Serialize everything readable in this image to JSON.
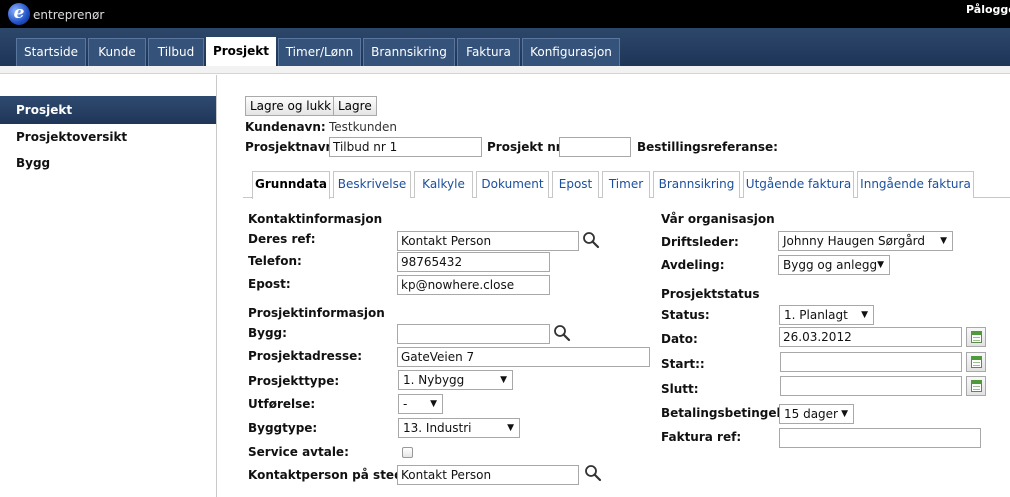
{
  "app": {
    "logo_letter": "e",
    "logo_text": "entreprenør",
    "login_label": "Pålogget"
  },
  "nav": {
    "tabs": [
      "Startside",
      "Kunde",
      "Tilbud",
      "Prosjekt",
      "Timer/Lønn",
      "Brannsikring",
      "Faktura",
      "Konfigurasjon"
    ],
    "active": "Prosjekt"
  },
  "sidebar": {
    "items": [
      "Prosjekt",
      "Prosjektoversikt",
      "Bygg"
    ],
    "active": "Prosjekt"
  },
  "toolbar": {
    "save_close_label": "Lagre og lukk",
    "save_label": "Lagre"
  },
  "header": {
    "customer_label": "Kundenavn:",
    "customer_value": "Testkunden",
    "project_name_label": "Prosjektnavn:",
    "project_name_value": "Tilbud nr 1",
    "project_nr_label": "Prosjekt nr:",
    "project_nr_value": "",
    "order_ref_label": "Bestillingsreferanse:"
  },
  "content_tabs": {
    "tabs": [
      "Grunndata",
      "Beskrivelse",
      "Kalkyle",
      "Dokument",
      "Epost",
      "Timer",
      "Brannsikring",
      "Utgående faktura",
      "Inngående faktura"
    ],
    "active": "Grunndata"
  },
  "contact": {
    "section_title": "Kontaktinformasjon",
    "ref_label": "Deres ref:",
    "ref_value": "Kontakt Person",
    "phone_label": "Telefon:",
    "phone_value": "98765432",
    "email_label": "Epost:",
    "email_value": "kp@nowhere.close"
  },
  "project_info": {
    "section_title": "Prosjektinformasjon",
    "building_label": "Bygg:",
    "building_value": "",
    "address_label": "Prosjektadresse:",
    "address_value": "GateVeien 7",
    "type_label": "Prosjekttype:",
    "type_value": "1. Nybygg",
    "execution_label": "Utførelse:",
    "execution_value": "-",
    "building_type_label": "Byggtype:",
    "building_type_value": "13. Industri",
    "service_label": "Service avtale:",
    "service_checked": false,
    "onsite_contact_label": "Kontaktperson på stedet:",
    "onsite_contact_value": "Kontakt Person"
  },
  "organisation": {
    "section_title": "Vår organisasjon",
    "manager_label": "Driftsleder:",
    "manager_value": "Johnny Haugen Sørgård",
    "department_label": "Avdeling:",
    "department_value": "Bygg og anlegg"
  },
  "status": {
    "section_title": "Prosjektstatus",
    "status_label": "Status:",
    "status_value": "1. Planlagt",
    "date_label": "Dato:",
    "date_value": "26.03.2012",
    "start_label": "Start::",
    "start_value": "",
    "end_label": "Slutt:",
    "end_value": "",
    "payment_label": "Betalingsbetingelse",
    "payment_value": "15 dager",
    "invoice_ref_label": "Faktura ref:",
    "invoice_ref_value": ""
  },
  "icons": {
    "search": "search-icon",
    "calendar": "calendar-icon",
    "dropdown": "chevron-down-icon"
  },
  "colors": {
    "nav_bg": "#1d3557",
    "sidebar_active": "#2f4a70",
    "link": "#1b4f9c"
  }
}
